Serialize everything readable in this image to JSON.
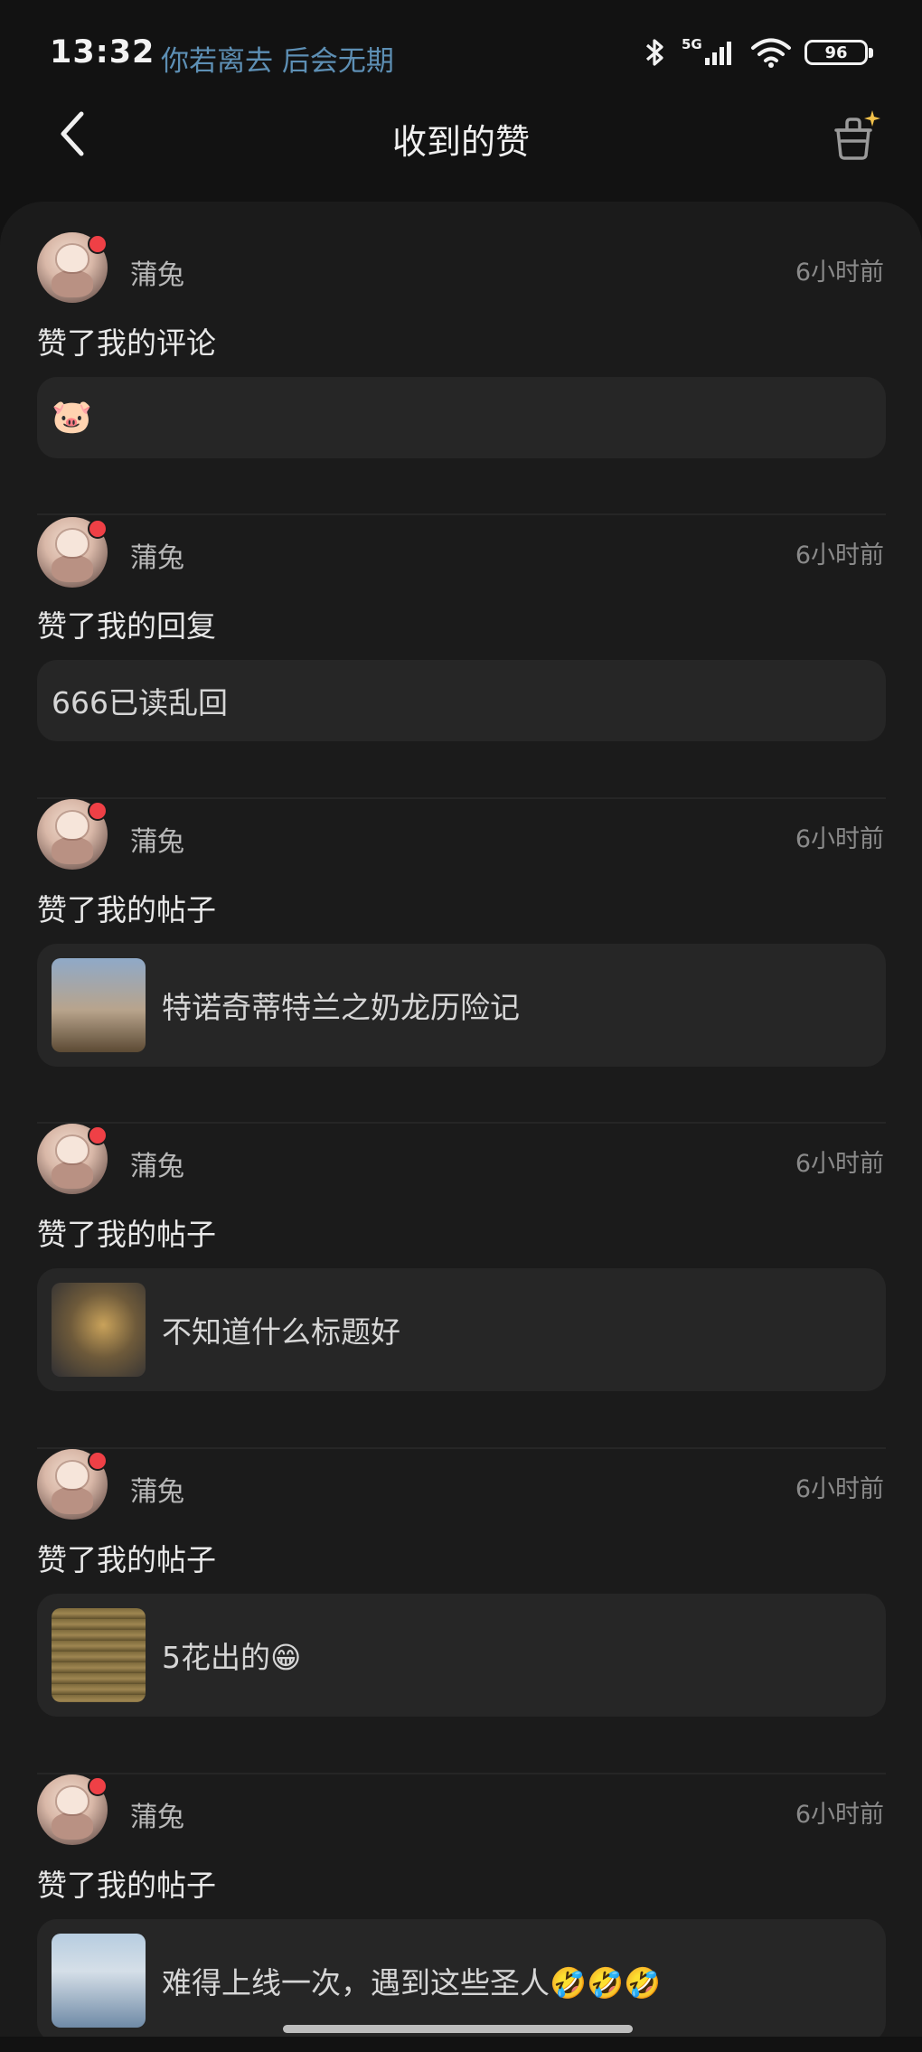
{
  "status_bar": {
    "time": "13:32",
    "song": "你若离去 后会无期",
    "network": "5G",
    "battery": "96"
  },
  "header": {
    "title": "收到的赞"
  },
  "items": [
    {
      "username": "蒲兔",
      "time": "6小时前",
      "action": "赞了我的评论",
      "content": "🐷",
      "has_thumb": false
    },
    {
      "username": "蒲兔",
      "time": "6小时前",
      "action": "赞了我的回复",
      "content": "666已读乱回",
      "has_thumb": false
    },
    {
      "username": "蒲兔",
      "time": "6小时前",
      "action": "赞了我的帖子",
      "content": "特诺奇蒂特兰之奶龙历险记",
      "has_thumb": true
    },
    {
      "username": "蒲兔",
      "time": "6小时前",
      "action": "赞了我的帖子",
      "content": "不知道什么标题好",
      "has_thumb": true
    },
    {
      "username": "蒲兔",
      "time": "6小时前",
      "action": "赞了我的帖子",
      "content": "5花出的😁",
      "has_thumb": true
    },
    {
      "username": "蒲兔",
      "time": "6小时前",
      "action": "赞了我的帖子",
      "content": "难得上线一次，遇到这些圣人🤣🤣🤣",
      "has_thumb": true
    }
  ],
  "colors": {
    "background": "#121212",
    "panel": "#1b1b1b",
    "content_box": "#262626",
    "notification_dot": "#ef4046",
    "song_text": "#5d8fb4"
  }
}
